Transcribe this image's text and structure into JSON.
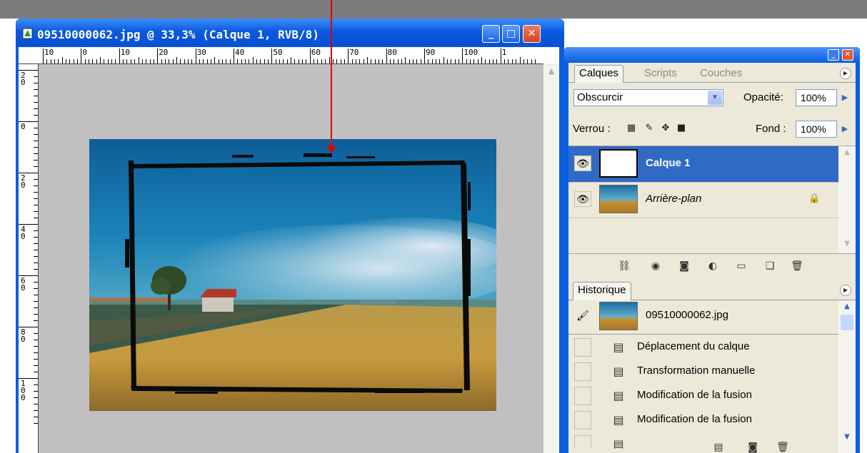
{
  "document": {
    "title": "09510000062.jpg @ 33,3% (Calque 1, RVB/8)",
    "ruler_h_labels": [
      "10",
      "0",
      "10",
      "20",
      "30",
      "40",
      "50",
      "60",
      "70",
      "80",
      "90",
      "100",
      "1"
    ],
    "ruler_v_labels": [
      "2\n0",
      "0",
      "2\n0",
      "4\n0",
      "6\n0",
      "8\n0",
      "1\n0\n0"
    ]
  },
  "window_controls": {
    "minimize": "_",
    "maximize": "□",
    "close": "✕"
  },
  "layers_panel": {
    "tabs": [
      "Calques",
      "Scripts",
      "Couches"
    ],
    "blend_mode": "Obscurcir",
    "opacity_label": "Opacité:",
    "opacity_value": "100%",
    "lock_label": "Verrou :",
    "fill_label": "Fond :",
    "fill_value": "100%",
    "layers": [
      {
        "name": "Calque 1",
        "selected": true
      },
      {
        "name": "Arrière-plan",
        "selected": false,
        "locked": true
      }
    ]
  },
  "history_panel": {
    "tab": "Historique",
    "source": "09510000062.jpg",
    "items": [
      "Déplacement du calque",
      "Transformation manuelle",
      "Modification de la fusion",
      "Modification de la fusion"
    ]
  },
  "colors": {
    "titlebar": "#0a58e0",
    "selection": "#316ac5",
    "arrow": "#e00000",
    "panel_bg": "#ece9d8"
  }
}
